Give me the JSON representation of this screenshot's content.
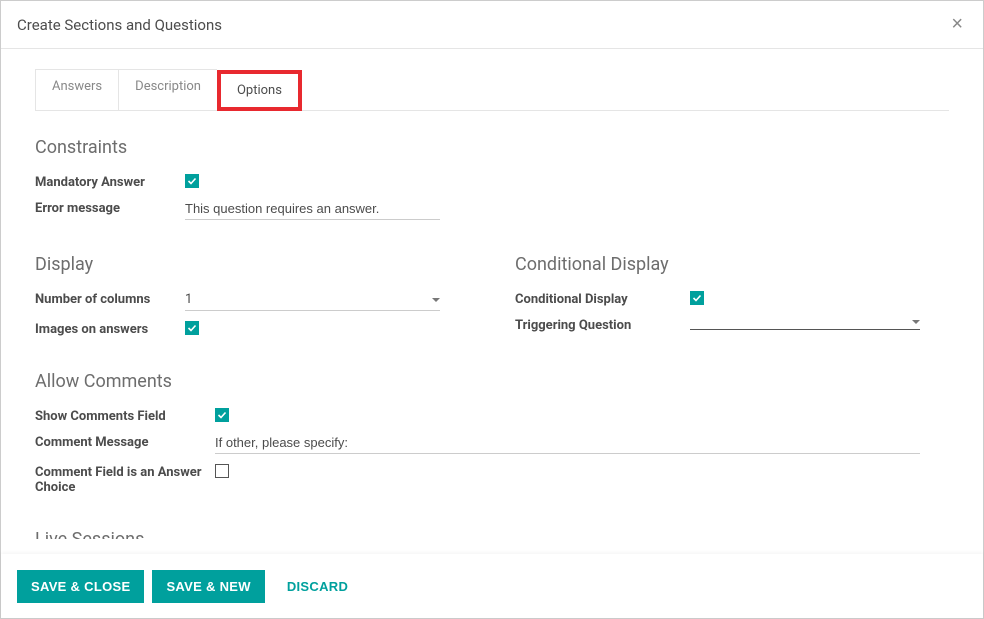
{
  "modal": {
    "title": "Create Sections and Questions"
  },
  "tabs": [
    {
      "label": "Answers"
    },
    {
      "label": "Description"
    },
    {
      "label": "Options"
    }
  ],
  "constraints": {
    "title": "Constraints",
    "mandatory_label": "Mandatory Answer",
    "mandatory_checked": true,
    "error_label": "Error message",
    "error_value": "This question requires an answer."
  },
  "display": {
    "title": "Display",
    "columns_label": "Number of columns",
    "columns_value": "1",
    "images_label": "Images on answers",
    "images_checked": true
  },
  "conditional": {
    "title": "Conditional Display",
    "display_label": "Conditional Display",
    "display_checked": true,
    "trigger_label": "Triggering Question",
    "trigger_value": ""
  },
  "comments": {
    "title": "Allow Comments",
    "show_label": "Show Comments Field",
    "show_checked": true,
    "message_label": "Comment Message",
    "message_value": "If other, please specify:",
    "answer_choice_label": "Comment Field is an Answer Choice",
    "answer_choice_checked": false
  },
  "live_sessions": {
    "title": "Live Sessions"
  },
  "footer": {
    "save_close": "SAVE & CLOSE",
    "save_new": "SAVE & NEW",
    "discard": "DISCARD"
  }
}
